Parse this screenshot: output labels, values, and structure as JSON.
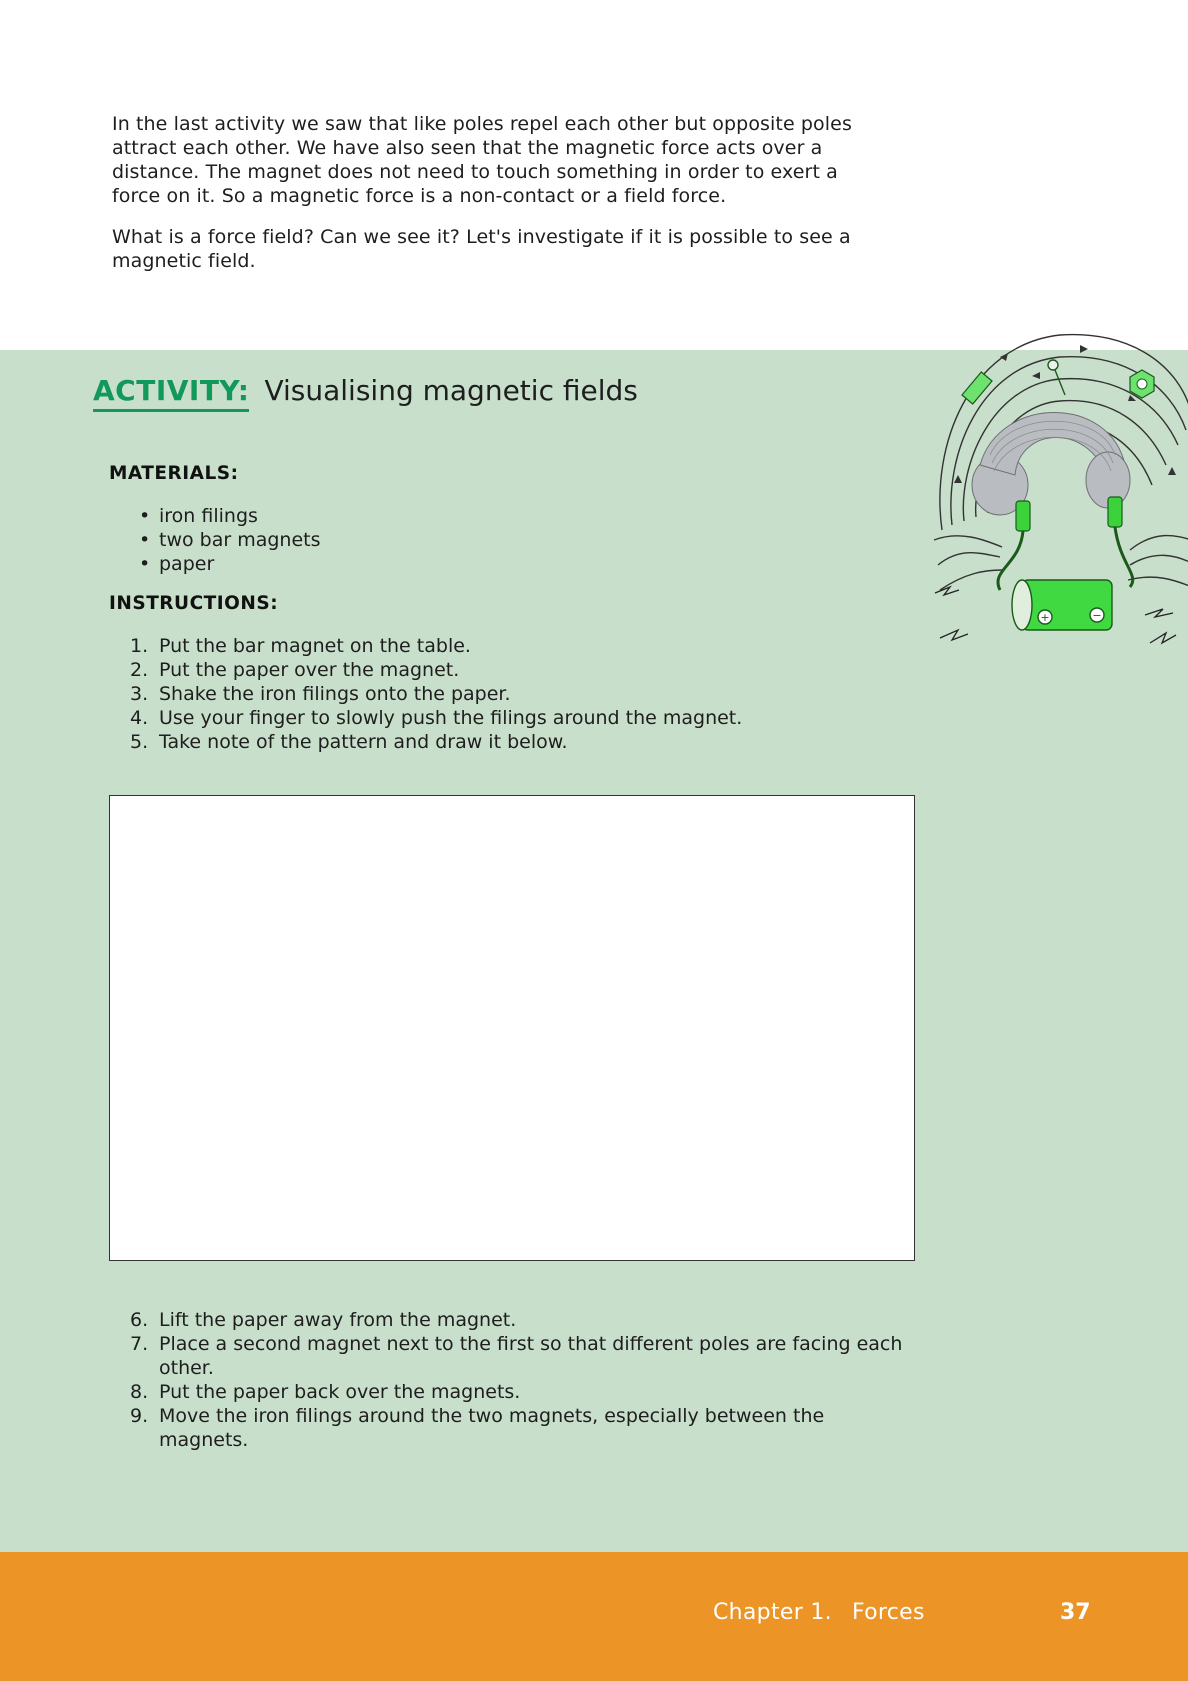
{
  "intro": {
    "paragraphs": [
      "In the last activity we saw that like poles repel each other but opposite poles attract each other. We have also seen that the magnetic force acts over a distance. The magnet does not need to touch something in order to exert a force on it. So a magnetic force is a non-contact or a field force.",
      "What is a force field? Can we see it? Let's investigate if it is possible to see a magnetic field."
    ]
  },
  "activity": {
    "label": "ACTIVITY:",
    "title": "Visualising magnetic fields",
    "materials_heading": "MATERIALS:",
    "materials": [
      "iron filings",
      "two bar magnets",
      "paper"
    ],
    "instructions_heading": "INSTRUCTIONS:",
    "steps_part1": [
      {
        "num": "1.",
        "text": "Put the bar magnet on the table."
      },
      {
        "num": "2.",
        "text": "Put the paper over the magnet."
      },
      {
        "num": "3.",
        "text": "Shake the iron filings onto the paper."
      },
      {
        "num": "4.",
        "text": "Use your finger to slowly push the filings around the magnet."
      },
      {
        "num": "5.",
        "text": "Take note of the pattern and draw it below."
      }
    ],
    "steps_part2": [
      {
        "num": "6.",
        "text": "Lift the paper away from the magnet."
      },
      {
        "num": "7.",
        "text": "Place a second magnet next to the first so that different poles are facing each other."
      },
      {
        "num": "8.",
        "text": "Put the paper back over the magnets."
      },
      {
        "num": "9.",
        "text": "Move the iron filings around the two magnets, especially between the magnets."
      }
    ],
    "illustration_icon": "electromagnet-spring-battery-illustration",
    "background_color": "#c8dfcb",
    "accent_color": "#12985a"
  },
  "footer": {
    "chapter_label": "Chapter 1.",
    "chapter_name": "Forces",
    "page_number": "37",
    "background_color": "#ec9426"
  }
}
